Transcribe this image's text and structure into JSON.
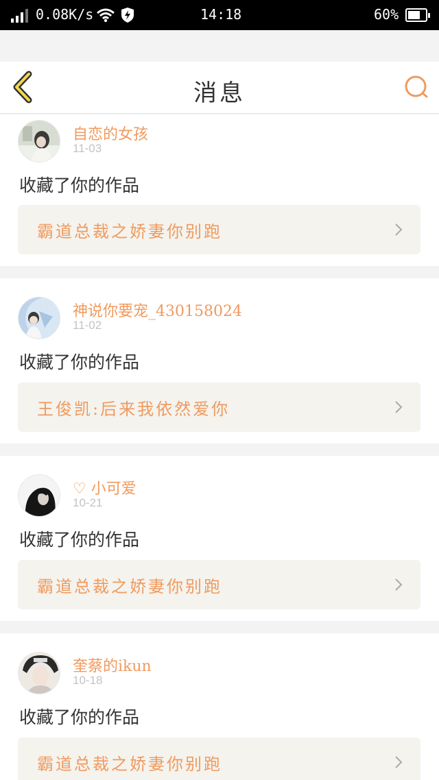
{
  "status_bar": {
    "network_speed": "0.08K/s",
    "time": "14:18",
    "battery_level": "60%",
    "icons": [
      "signal-icon",
      "wifi-icon",
      "shield-icon",
      "battery-icon"
    ]
  },
  "header": {
    "title": "消息",
    "back_icon": "back-chevron-icon",
    "search_icon": "search-icon",
    "accent_color": "#f09a5e"
  },
  "messages": [
    {
      "username": "自恋的女孩",
      "date": "11-03",
      "action": "收藏了你的作品",
      "work_title": "霸道总裁之娇妻你别跑"
    },
    {
      "username": "神说你要宠_430158024",
      "date": "11-02",
      "action": "收藏了你的作品",
      "work_title": "王俊凯:后来我依然爱你"
    },
    {
      "username": "♡ 小可爱",
      "date": "10-21",
      "action": "收藏了你的作品",
      "work_title": "霸道总裁之娇妻你别跑"
    },
    {
      "username": "奎蔡的ikun",
      "date": "10-18",
      "action": "收藏了你的作品",
      "work_title": "霸道总裁之娇妻你别跑"
    }
  ]
}
